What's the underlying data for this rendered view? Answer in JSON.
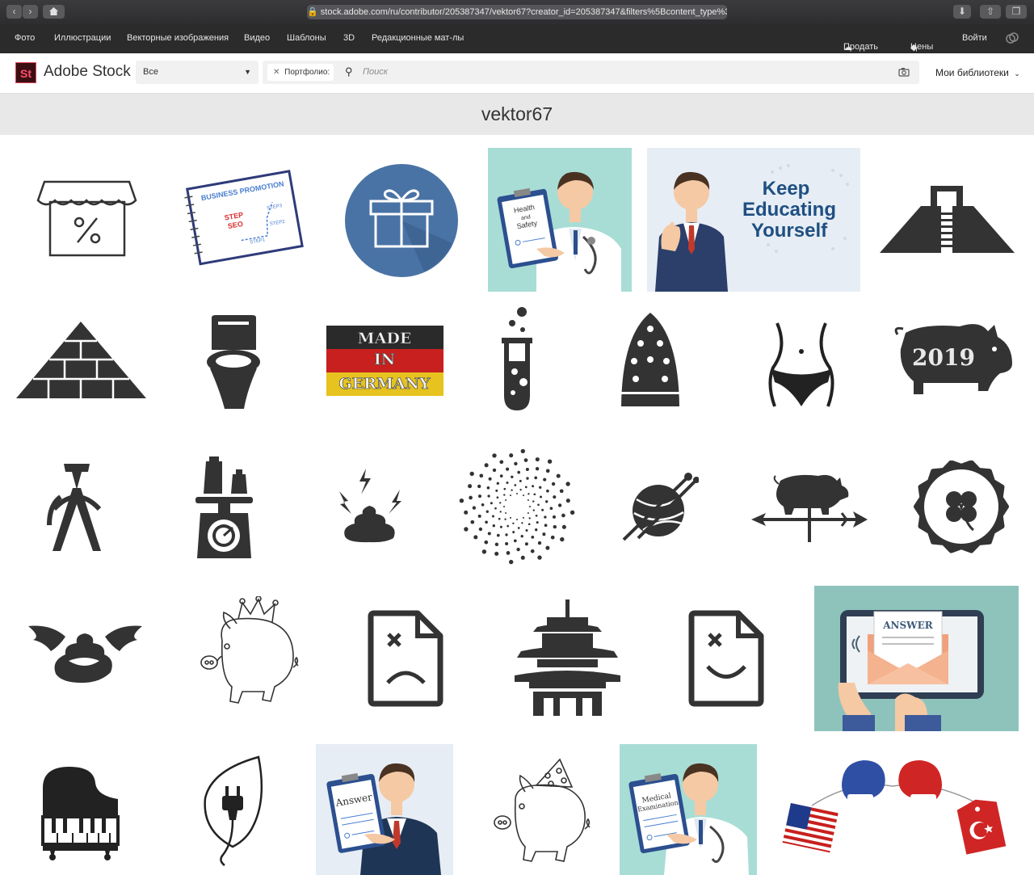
{
  "browser": {
    "url": "stock.adobe.com/ru/contributor/205387347/vektor67?creator_id=205387347&filters%5Bcontent_type%3A..."
  },
  "topnav": {
    "items": [
      "Фото",
      "Иллюстрации",
      "Векторные изображения",
      "Видео",
      "Шаблоны",
      "3D",
      "Редакционные мат-лы"
    ],
    "sell": "Продать",
    "pricing": "Цены",
    "signin": "Войти"
  },
  "header": {
    "logo": "St",
    "brand": "Adobe Stock",
    "filter_value": "Все",
    "chip_label": "Портфолио:",
    "search_placeholder": "Поиск",
    "libraries": "Мои библиотеки"
  },
  "contributor": {
    "name": "vektor67"
  },
  "colors": {
    "icon": "#333333",
    "accent_blue": "#4a73a5",
    "teal": "#a8ddd6",
    "light_blue": "#e6edf4",
    "brand_red": "#ff4f6b"
  },
  "tiles": [
    {
      "icon": "shop-discount-icon"
    },
    {
      "icon": "business-promotion-notebook",
      "text": [
        "BUSINESS PROMOTION",
        "STEP",
        "SEO",
        "STEP1",
        "STEP2",
        "STEP3"
      ]
    },
    {
      "icon": "gift-box-circle-icon"
    },
    {
      "icon": "doctor-health-safety",
      "text": [
        "Health",
        "and",
        "Safety"
      ]
    },
    {
      "icon": "keep-educating-banner",
      "text": [
        "Keep",
        "Educating",
        "Yourself"
      ]
    },
    {
      "icon": "mayan-pyramid-icon"
    },
    {
      "icon": "brick-pyramid-icon"
    },
    {
      "icon": "toilet-icon"
    },
    {
      "icon": "made-in-germany-sign",
      "text": [
        "MADE",
        "IN",
        "GERMANY"
      ]
    },
    {
      "icon": "test-tube-icon"
    },
    {
      "icon": "iron-soleplate-icon"
    },
    {
      "icon": "female-body-icon"
    },
    {
      "icon": "pig-2019-icon",
      "text": [
        "2019"
      ]
    },
    {
      "icon": "drawing-compass-icon"
    },
    {
      "icon": "kitchen-scale-icon"
    },
    {
      "icon": "poop-lightning-icon"
    },
    {
      "icon": "dotted-spiral-icon"
    },
    {
      "icon": "yarn-ball-icon"
    },
    {
      "icon": "pig-weathervane-icon"
    },
    {
      "icon": "four-leaf-clover-badge-icon"
    },
    {
      "icon": "winged-poop-icon"
    },
    {
      "icon": "pig-with-crown-icon"
    },
    {
      "icon": "sad-document-icon"
    },
    {
      "icon": "pagoda-icon"
    },
    {
      "icon": "smile-document-icon"
    },
    {
      "icon": "answer-tablet-illustration",
      "text": [
        "ANSWER"
      ]
    },
    {
      "icon": "grand-piano-icon"
    },
    {
      "icon": "leaf-plug-icon"
    },
    {
      "icon": "businessman-answer-clipboard",
      "text": [
        "Answer"
      ]
    },
    {
      "icon": "pig-party-hat-icon"
    },
    {
      "icon": "doctor-medical-examination",
      "text": [
        "Medical",
        "Examination"
      ]
    },
    {
      "icon": "boxing-usa-turkey"
    }
  ]
}
